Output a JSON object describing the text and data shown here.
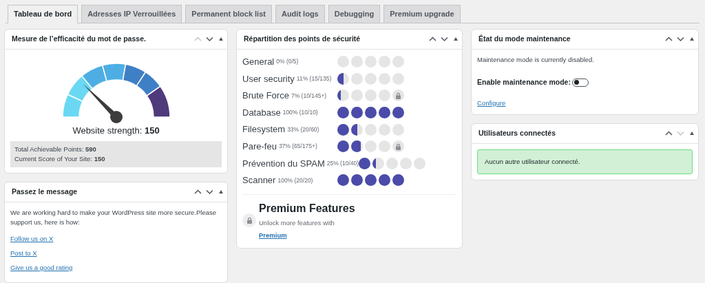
{
  "tabs": [
    {
      "label": "Tableau de bord",
      "selected": true
    },
    {
      "label": "Adresses IP Verrouillées",
      "selected": false
    },
    {
      "label": "Permanent block list",
      "selected": false
    },
    {
      "label": "Audit logs",
      "selected": false
    },
    {
      "label": "Debugging",
      "selected": false
    },
    {
      "label": "Premium upgrade",
      "selected": false
    }
  ],
  "columns": [
    [
      {
        "kind": "gauge",
        "title": "Mesure de l’efficacité du mot de passe.",
        "up_disabled": true,
        "down_disabled": false,
        "strength": "Website strength: **150**",
        "stats": [
          "Total Achievable Points: **590**",
          "Current Score of Your Site: **150**"
        ]
      },
      {
        "kind": "message",
        "title": "Passez le message",
        "up_disabled": false,
        "down_disabled": false,
        "text": "We are working hard to make your WordPress site more secure.Please support us, here is how:",
        "links": [
          "Follow us on X",
          "Post to X",
          "Give us a good rating"
        ]
      }
    ],
    [
      {
        "kind": "points",
        "title": "Répartition des points de sécurité",
        "up_disabled": false,
        "down_disabled": false,
        "rows": [
          {
            "name": "General",
            "detail": "0% (0/5)",
            "dots": [
              {
                "kind": "empty"
              },
              {
                "kind": "empty"
              },
              {
                "kind": "empty"
              },
              {
                "kind": "empty"
              },
              {
                "kind": "empty"
              }
            ]
          },
          {
            "name": "User security",
            "detail": "11% (15/135)",
            "dots": [
              {
                "kind": "half"
              },
              {
                "kind": "empty"
              },
              {
                "kind": "empty"
              },
              {
                "kind": "empty"
              },
              {
                "kind": "empty"
              }
            ]
          },
          {
            "name": "Brute Force",
            "detail": "7% (10/145+)",
            "dots": [
              {
                "kind": "sliver"
              },
              {
                "kind": "empty"
              },
              {
                "kind": "empty"
              },
              {
                "kind": "empty"
              },
              {
                "kind": "lock"
              }
            ]
          },
          {
            "name": "Database",
            "detail": "100% (10/10)",
            "dots": [
              {
                "kind": "full"
              },
              {
                "kind": "full"
              },
              {
                "kind": "full"
              },
              {
                "kind": "full"
              },
              {
                "kind": "full"
              }
            ]
          },
          {
            "name": "Filesystem",
            "detail": "33% (20/60)",
            "dots": [
              {
                "kind": "full"
              },
              {
                "kind": "half"
              },
              {
                "kind": "empty"
              },
              {
                "kind": "empty"
              },
              {
                "kind": "empty"
              }
            ]
          },
          {
            "name": "Pare-feu",
            "detail": "37% (65/175+)",
            "dots": [
              {
                "kind": "full"
              },
              {
                "kind": "most"
              },
              {
                "kind": "empty"
              },
              {
                "kind": "empty"
              },
              {
                "kind": "lock"
              }
            ]
          },
          {
            "name": "Prévention du SPAM",
            "detail": "25% (10/40)",
            "dots": [
              {
                "kind": "full"
              },
              {
                "kind": "sliver"
              },
              {
                "kind": "empty"
              },
              {
                "kind": "empty"
              },
              {
                "kind": "empty"
              }
            ]
          },
          {
            "name": "Scanner",
            "detail": "100% (20/20)",
            "dots": [
              {
                "kind": "full"
              },
              {
                "kind": "full"
              },
              {
                "kind": "full"
              },
              {
                "kind": "full"
              },
              {
                "kind": "full"
              }
            ]
          }
        ],
        "premium": {
          "title": "Premium Features",
          "text": "Unlock more features with",
          "link": "Premium"
        }
      }
    ],
    [
      {
        "kind": "maintenance",
        "title": "État du mode maintenance",
        "up_disabled": false,
        "down_disabled": false,
        "status": "Maintenance mode is currently disabled.",
        "toggle_label": "Enable maintenance mode:",
        "on": false,
        "link": "Configure"
      },
      {
        "kind": "notice",
        "title": "Utilisateurs connectés",
        "up_disabled": false,
        "down_disabled": true,
        "notice": "Aucun autre utilisateur connecté."
      }
    ]
  ]
}
